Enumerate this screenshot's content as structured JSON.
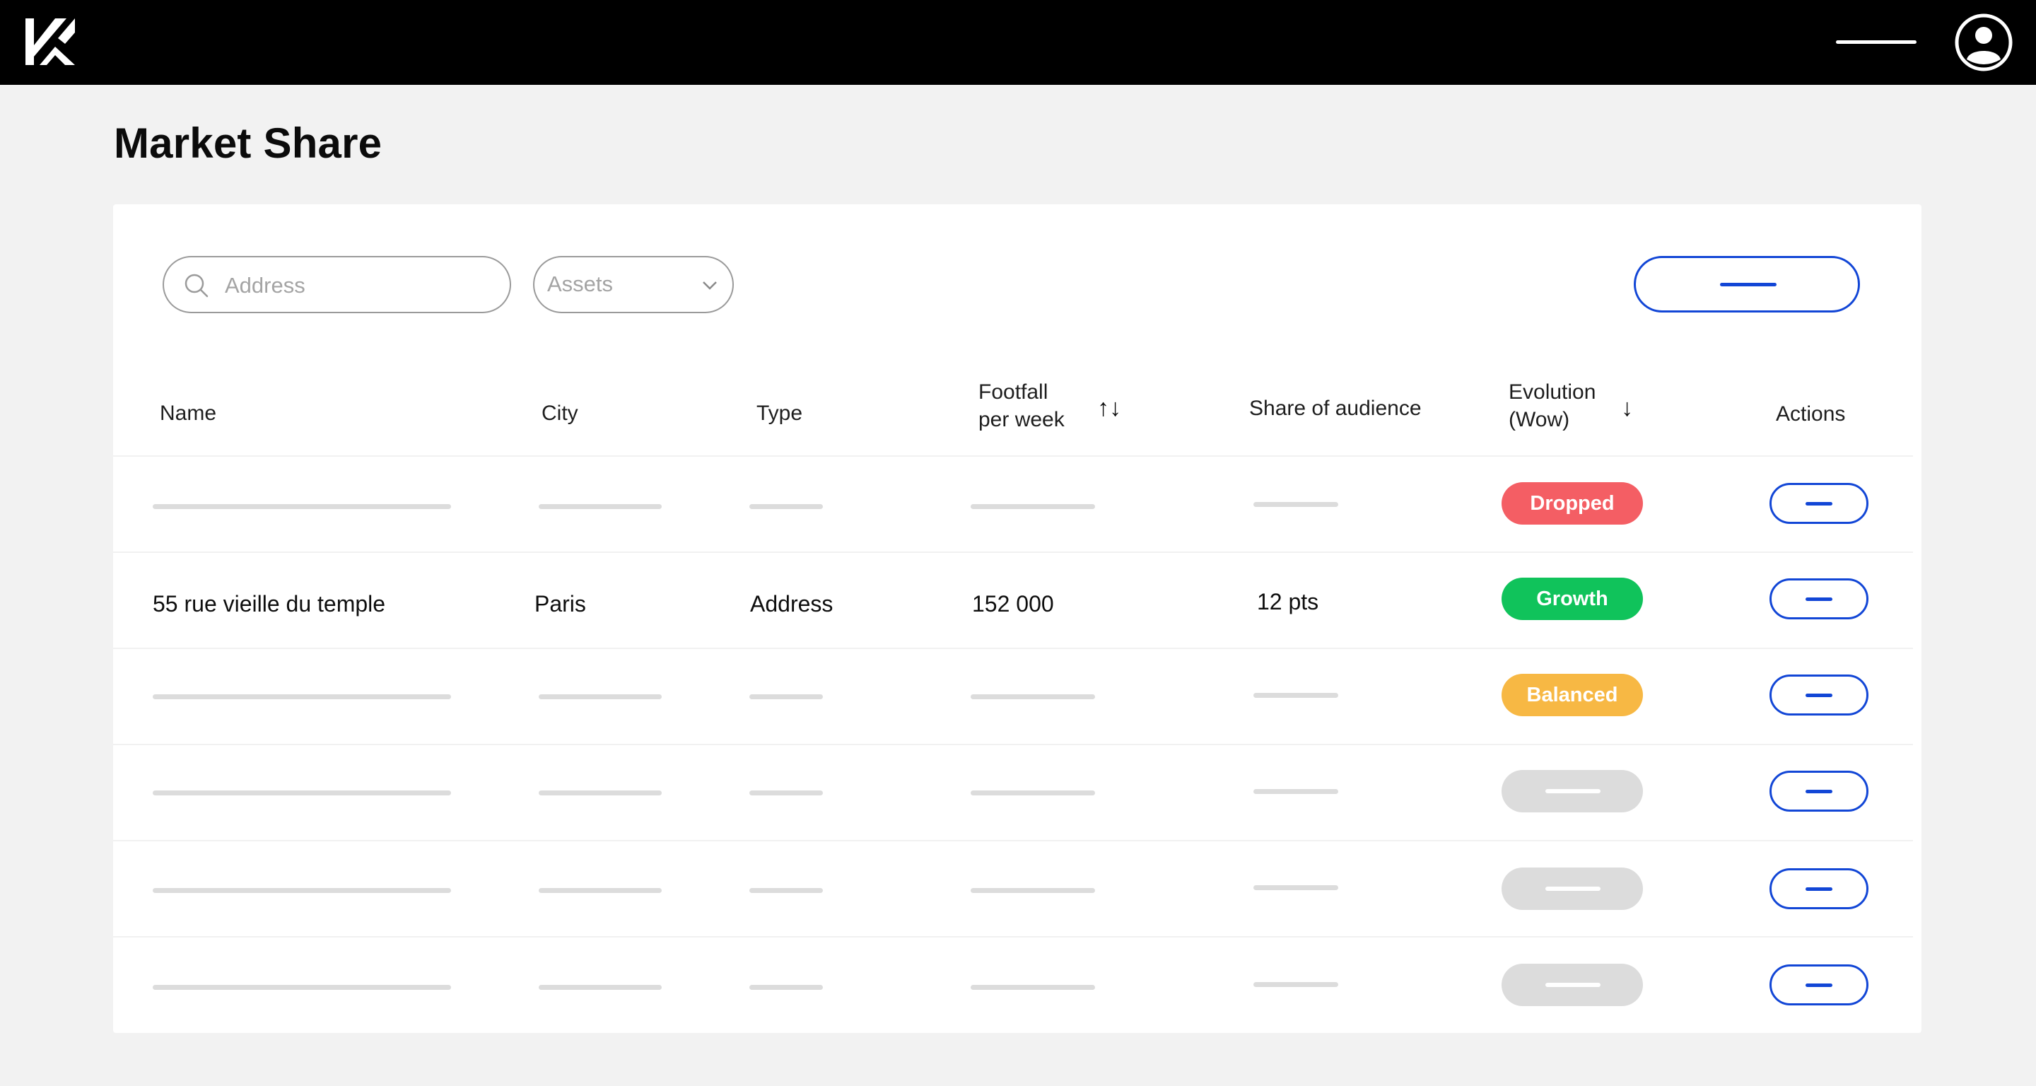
{
  "header": {
    "logo_icon": "brand-logo-icon",
    "menu_icon": "menu-line-icon",
    "avatar_icon": "user-avatar-icon"
  },
  "page": {
    "title": "Market Share"
  },
  "filters": {
    "search": {
      "placeholder": "Address",
      "icon": "search-icon"
    },
    "assets_select": {
      "selected": "Assets",
      "icon": "chevron-down-icon"
    }
  },
  "table": {
    "headers": {
      "name": "Name",
      "city": "City",
      "type": "Type",
      "footfall_line1": "Footfall",
      "footfall_line2": "per week",
      "footfall_sort": "↑↓",
      "share": "Share of audience",
      "evolution_line1": "Evolution",
      "evolution_line2": "(Wow)",
      "evolution_sort": "↓",
      "actions": "Actions"
    },
    "rows": [
      {
        "placeholder": true,
        "status": "Dropped",
        "status_color": "#f45e64"
      },
      {
        "placeholder": false,
        "name": "55 rue vieille du temple",
        "city": "Paris",
        "type": "Address",
        "footfall": "152 000",
        "share": "12 pts",
        "status": "Growth",
        "status_color": "#10c35b"
      },
      {
        "placeholder": true,
        "status": "Balanced",
        "status_color": "#f7b844"
      },
      {
        "placeholder": true,
        "status": "",
        "status_color": "#dcdcdc"
      },
      {
        "placeholder": true,
        "status": "",
        "status_color": "#dcdcdc"
      },
      {
        "placeholder": true,
        "status": "",
        "status_color": "#dcdcdc"
      }
    ]
  },
  "colors": {
    "accent": "#1246d6",
    "topbar": "#000000",
    "background": "#f2f2f2",
    "dropped": "#f45e64",
    "growth": "#10c35b",
    "balanced": "#f7b844",
    "neutral": "#dcdcdc"
  }
}
